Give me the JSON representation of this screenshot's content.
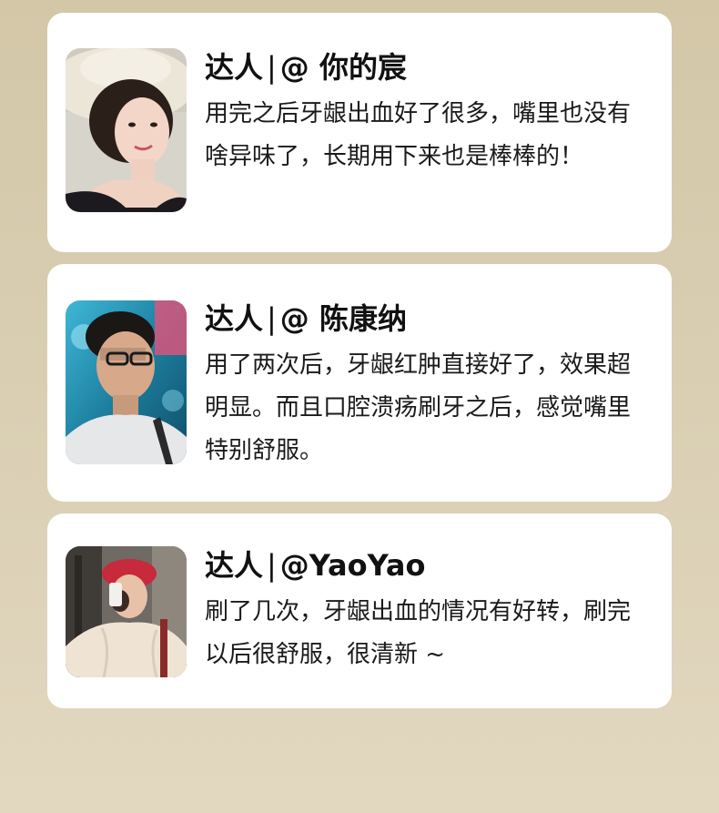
{
  "reviews": [
    {
      "author_prefix": "达人",
      "separator": "|",
      "author_handle": "@ 你的宸",
      "comment": "用完之后牙龈出血好了很多，嘴里也没有啥异味了，长期用下来也是棒棒的！",
      "avatar_icon": "woman-sunhat-photo"
    },
    {
      "author_prefix": "达人",
      "separator": "|",
      "author_handle": "@ 陈康纳",
      "comment": "用了两次后，牙龈红肿直接好了，效果超明显。而且口腔溃疡刷牙之后，感觉嘴里特别舒服。",
      "avatar_icon": "man-glasses-photo"
    },
    {
      "author_prefix": "达人",
      "separator": "|",
      "author_handle": "@YaoYao",
      "comment": "刷了几次，牙龈出血的情况有好转，刷完以后很舒服，很清新 ~",
      "avatar_icon": "woman-beret-photo"
    }
  ]
}
